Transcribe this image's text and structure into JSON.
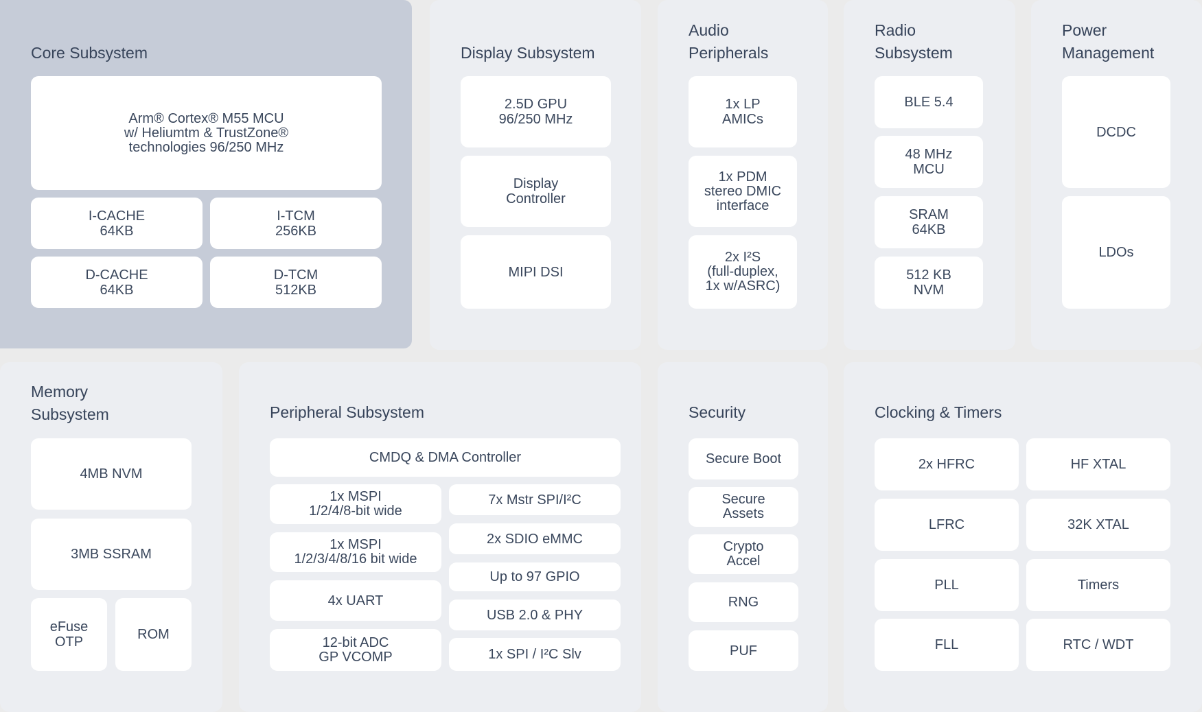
{
  "panels": {
    "core": {
      "title": "Core Subsystem",
      "mcu": "Arm® Cortex® M55 MCU\nw/ Heliumtm & TrustZone®\ntechnologies 96/250 MHz",
      "icache": "I-CACHE\n64KB",
      "itcm": "I-TCM\n256KB",
      "dcache": "D-CACHE\n64KB",
      "dtcm": "D-TCM\n512KB"
    },
    "display": {
      "title": "Display Subsystem",
      "items": [
        "2.5D GPU\n96/250 MHz",
        "Display\nController",
        "MIPI DSI"
      ]
    },
    "audio": {
      "title": "Audio\nPeripherals",
      "items": [
        "1x LP\nAMICs",
        "1x PDM\nstereo DMIC\ninterface",
        "2x I²S\n(full-duplex,\n1x w/ASRC)"
      ]
    },
    "radio": {
      "title": "Radio\nSubsystem",
      "items": [
        "BLE 5.4",
        "48 MHz\nMCU",
        "SRAM\n64KB",
        "512 KB\nNVM"
      ]
    },
    "power": {
      "title": "Power\nManagement",
      "items": [
        "DCDC",
        "LDOs"
      ]
    },
    "memory": {
      "title": "Memory\nSubsystem",
      "nvm": "4MB NVM",
      "ssram": "3MB SSRAM",
      "efuse": "eFuse\nOTP",
      "rom": "ROM"
    },
    "peripheral": {
      "title": "Peripheral Subsystem",
      "cmdq": "CMDQ & DMA Controller",
      "left": [
        "1x MSPI\n1/2/4/8-bit wide",
        "1x MSPI\n1/2/3/4/8/16 bit wide",
        "4x UART",
        "12-bit ADC\nGP VCOMP"
      ],
      "right": [
        "7x Mstr SPI/I²C",
        "2x SDIO eMMC",
        "Up to 97 GPIO",
        "USB 2.0 & PHY",
        "1x SPI / I²C Slv"
      ]
    },
    "security": {
      "title": "Security",
      "items": [
        "Secure Boot",
        "Secure\nAssets",
        "Crypto\nAccel",
        "RNG",
        "PUF"
      ]
    },
    "clocking": {
      "title": "Clocking & Timers",
      "left": [
        "2x HFRC",
        "LFRC",
        "PLL",
        "FLL"
      ],
      "right": [
        "HF XTAL",
        "32K XTAL",
        "Timers",
        "RTC / WDT"
      ]
    }
  }
}
